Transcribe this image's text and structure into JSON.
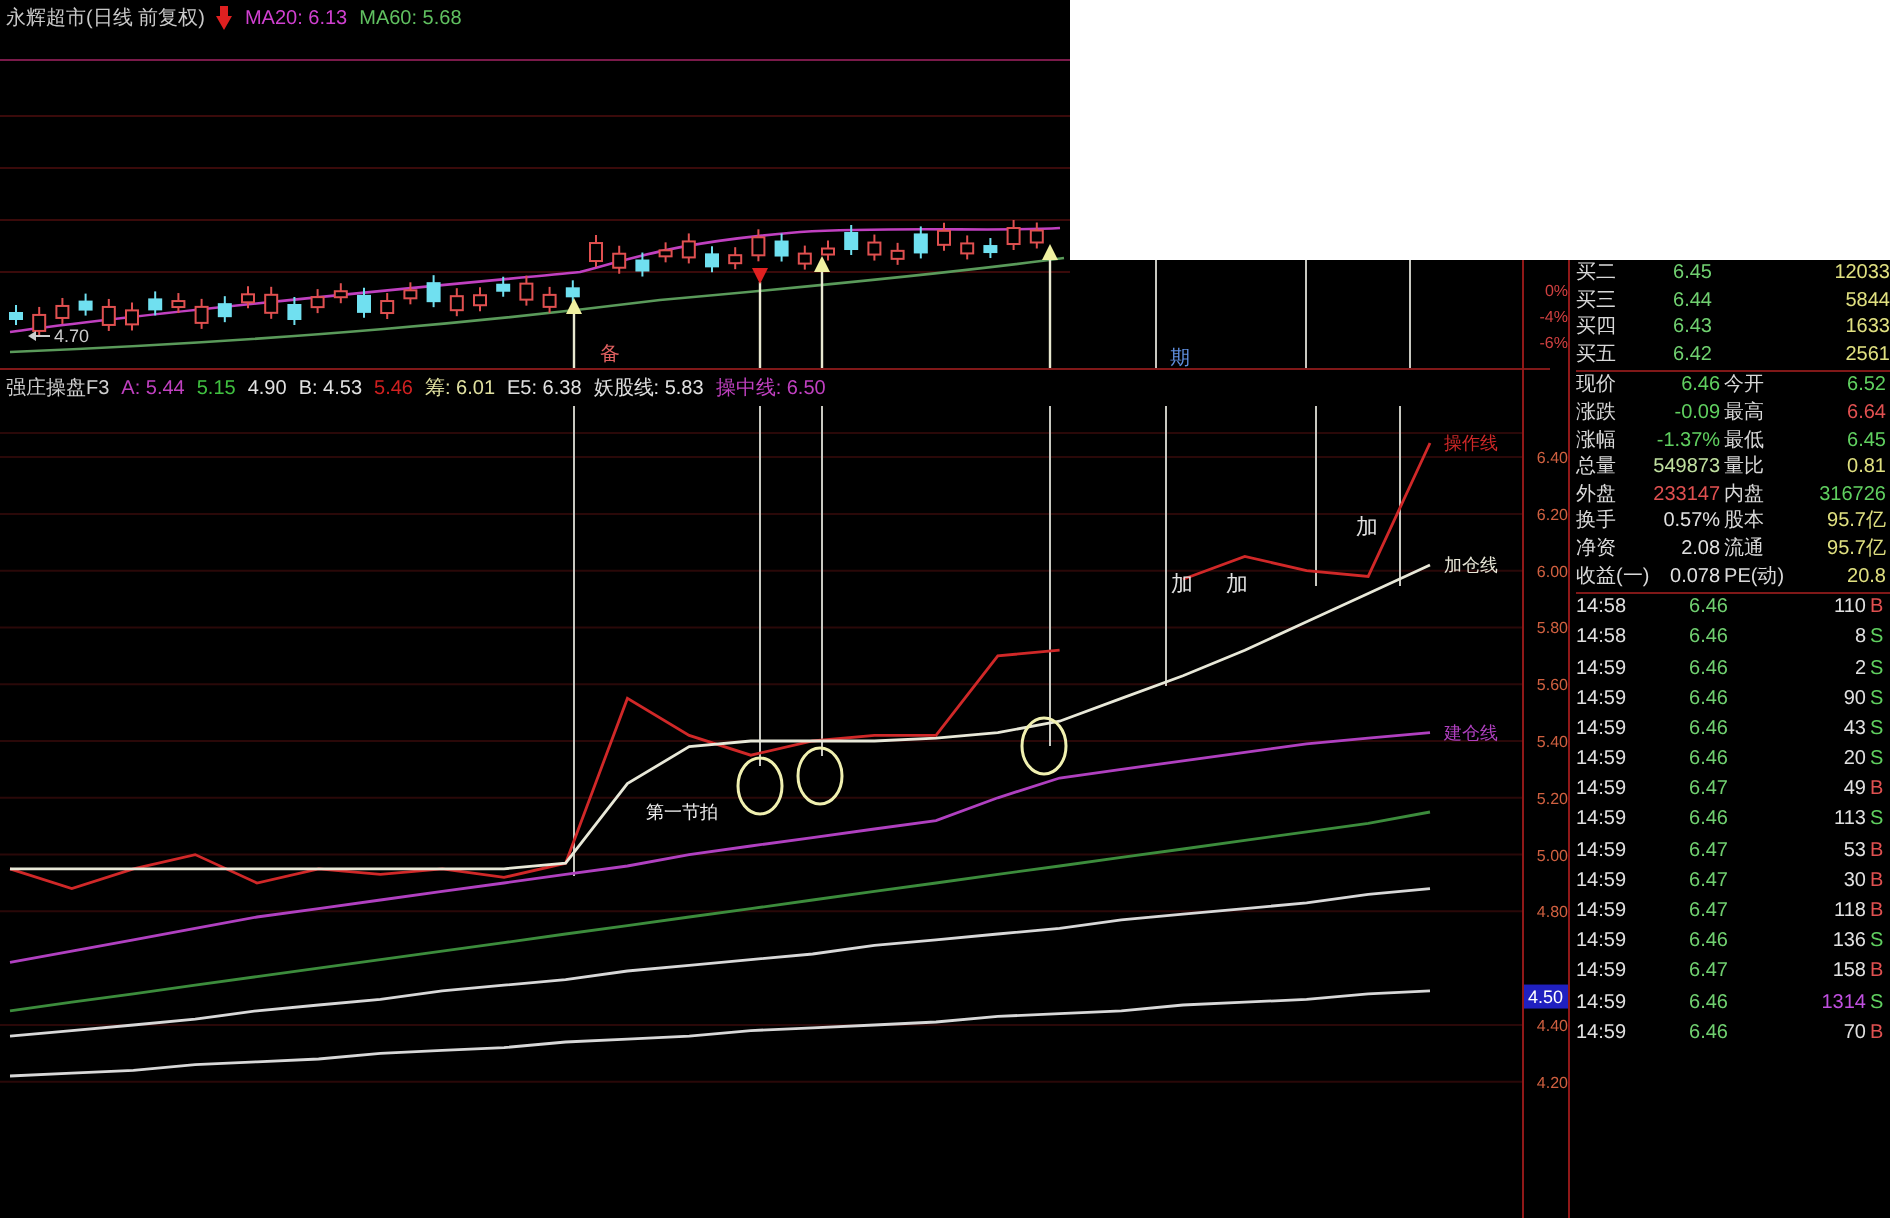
{
  "candle_pane": {
    "title": "永辉超市(日线 前复权)",
    "indicators": [
      {
        "text": "MA20: 6.13",
        "color": "#d040d0"
      },
      {
        "text": "MA60: 5.68",
        "color": "#60c060"
      }
    ],
    "low_label": "4.70",
    "marks": [
      {
        "text": "备",
        "color": "#e06060"
      }
    ]
  },
  "top_gap": {
    "marks": [
      {
        "text": "期",
        "color": "#6090e0"
      }
    ]
  },
  "axis": {
    "top_labels": [
      "0%",
      "-4%",
      "-6%"
    ],
    "price_labels": [
      "6.40",
      "6.20",
      "6.00",
      "5.80",
      "5.60",
      "5.40",
      "5.20",
      "5.00",
      "4.80",
      "4.40",
      "4.20"
    ],
    "price_tag": "4.50"
  },
  "main_chart": {
    "indicators": [
      {
        "text": "强庄操盘F3",
        "color": "#d0d0d0"
      },
      {
        "text": "A: 5.44",
        "color": "#c040c0"
      },
      {
        "text": "5.15",
        "color": "#40c040"
      },
      {
        "text": "4.90",
        "color": "#e0e0e0"
      },
      {
        "text": "B: 4.53",
        "color": "#e0e0e0"
      },
      {
        "text": "5.46",
        "color": "#d02020"
      },
      {
        "text": "筹: 6.01",
        "color": "#e0e0a0"
      },
      {
        "text": "E5: 6.38",
        "color": "#e0e0e0"
      },
      {
        "text": "妖股线: 5.83",
        "color": "#e0e0e0"
      },
      {
        "text": "操中线: 6.50",
        "color": "#c040c0"
      }
    ],
    "annotations": [
      {
        "text": "第一节拍",
        "kind": "note"
      },
      {
        "text": "加",
        "kind": "add"
      },
      {
        "text": "加",
        "kind": "add"
      },
      {
        "text": "加",
        "kind": "add"
      }
    ],
    "line_labels": [
      {
        "text": "操作线",
        "color": "#d02828"
      },
      {
        "text": "加仓线",
        "color": "#e8e8d8"
      },
      {
        "text": "建仓线",
        "color": "#b040c0"
      }
    ]
  },
  "order_book": [
    {
      "label": "买二",
      "price": "6.45",
      "volume": "12033"
    },
    {
      "label": "买三",
      "price": "6.44",
      "volume": "5844"
    },
    {
      "label": "买四",
      "price": "6.43",
      "volume": "1633"
    },
    {
      "label": "买五",
      "price": "6.42",
      "volume": "2561"
    }
  ],
  "quote": [
    {
      "label": "现价",
      "value": "6.46",
      "color": "#60d060"
    },
    {
      "label": "今开",
      "value": "6.52",
      "color": "#60d060"
    },
    {
      "label": "涨跌",
      "value": "-0.09",
      "color": "#60d060"
    },
    {
      "label": "最高",
      "value": "6.64",
      "color": "#e05050"
    },
    {
      "label": "涨幅",
      "value": "-1.37%",
      "color": "#60d060"
    },
    {
      "label": "最低",
      "value": "6.45",
      "color": "#60d060"
    },
    {
      "label": "总量",
      "value": "549873",
      "color": "#c0e0a0"
    },
    {
      "label": "量比",
      "value": "0.81",
      "color": "#e0e080"
    },
    {
      "label": "外盘",
      "value": "233147",
      "color": "#e05050"
    },
    {
      "label": "内盘",
      "value": "316726",
      "color": "#60d060"
    },
    {
      "label": "换手",
      "value": "0.57%",
      "color": "#e0e0e0"
    },
    {
      "label": "股本",
      "value": "95.7亿",
      "color": "#e0e080"
    },
    {
      "label": "净资",
      "value": "2.08",
      "color": "#e0e0e0"
    },
    {
      "label": "流通",
      "value": "95.7亿",
      "color": "#e0e080"
    },
    {
      "label": "收益(一)",
      "value": "0.078",
      "color": "#e0e0e0"
    },
    {
      "label": "PE(动)",
      "value": "20.8",
      "color": "#e0e080"
    }
  ],
  "ticks": [
    {
      "time": "14:58",
      "price": "6.46",
      "volume": "110",
      "side": "B",
      "kind": "buy",
      "big": false
    },
    {
      "time": "14:58",
      "price": "6.46",
      "volume": "8",
      "side": "S",
      "kind": "sell",
      "big": false
    },
    {
      "time": "14:59",
      "price": "6.46",
      "volume": "2",
      "side": "S",
      "kind": "sell",
      "big": false
    },
    {
      "time": "14:59",
      "price": "6.46",
      "volume": "90",
      "side": "S",
      "kind": "sell",
      "big": false
    },
    {
      "time": "14:59",
      "price": "6.46",
      "volume": "43",
      "side": "S",
      "kind": "sell",
      "big": false
    },
    {
      "time": "14:59",
      "price": "6.46",
      "volume": "20",
      "side": "S",
      "kind": "sell",
      "big": false
    },
    {
      "time": "14:59",
      "price": "6.47",
      "volume": "49",
      "side": "B",
      "kind": "buy",
      "big": false
    },
    {
      "time": "14:59",
      "price": "6.46",
      "volume": "113",
      "side": "S",
      "kind": "sell",
      "big": false
    },
    {
      "time": "14:59",
      "price": "6.47",
      "volume": "53",
      "side": "B",
      "kind": "buy",
      "big": false
    },
    {
      "time": "14:59",
      "price": "6.47",
      "volume": "30",
      "side": "B",
      "kind": "buy",
      "big": false
    },
    {
      "time": "14:59",
      "price": "6.47",
      "volume": "118",
      "side": "B",
      "kind": "buy",
      "big": false
    },
    {
      "time": "14:59",
      "price": "6.46",
      "volume": "136",
      "side": "S",
      "kind": "sell",
      "big": false
    },
    {
      "time": "14:59",
      "price": "6.47",
      "volume": "158",
      "side": "B",
      "kind": "buy",
      "big": false
    },
    {
      "time": "14:59",
      "price": "6.46",
      "volume": "1314",
      "side": "S",
      "kind": "sell",
      "big": true
    },
    {
      "time": "14:59",
      "price": "6.46",
      "volume": "70",
      "side": "B",
      "kind": "buy",
      "big": false
    }
  ]
}
